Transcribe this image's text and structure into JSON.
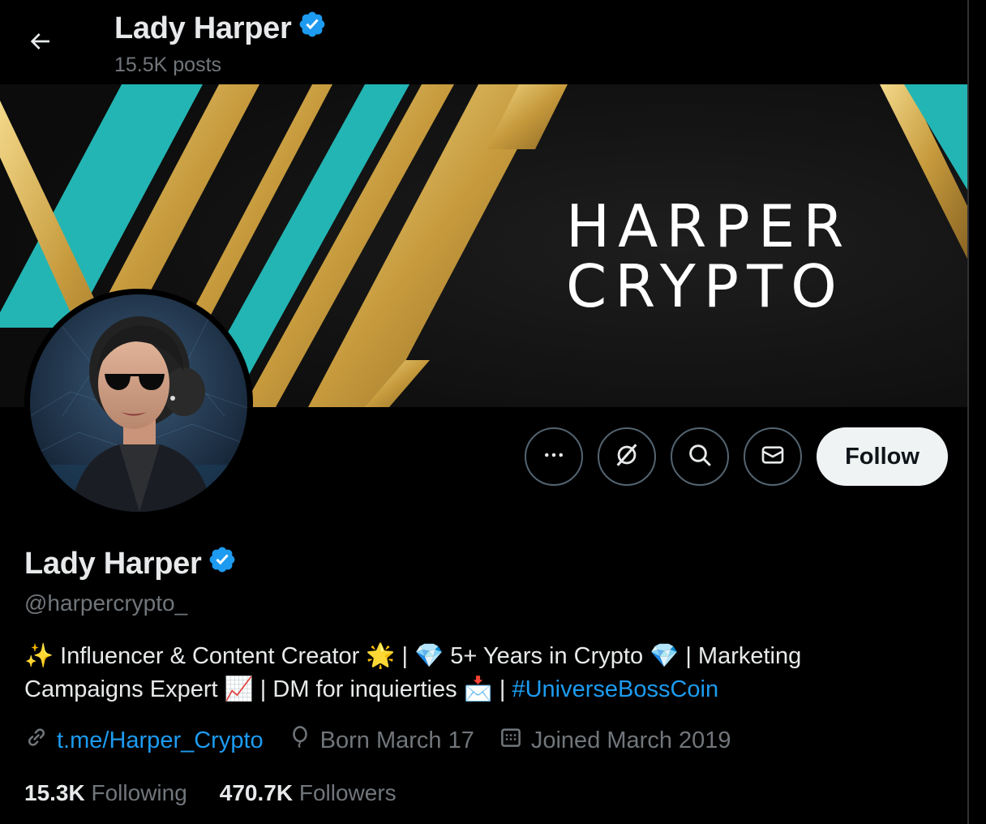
{
  "header": {
    "title": "Lady Harper",
    "posts_count": "15.5K posts"
  },
  "banner": {
    "line1": "HARPER",
    "line2": "CRYPTO",
    "colors": {
      "background": "#141414",
      "gold": "#c9a23f",
      "teal": "#23b5b3"
    }
  },
  "actions": {
    "more_icon": "more-dots-icon",
    "grok_icon": "grok-slash-icon",
    "search_icon": "search-icon",
    "message_icon": "envelope-icon",
    "follow_label": "Follow"
  },
  "profile": {
    "name": "Lady Harper",
    "handle": "@harpercrypto_",
    "verified_color": "#1d9bf0",
    "bio_line1": {
      "sparkles": "✨",
      "text1": " Influencer & Content Creator ",
      "glow": "🌟",
      "text2": " | ",
      "gem1": "💎",
      "text3": " 5+ Years in Crypto ",
      "gem2": "💎",
      "text4": " | Marketing"
    },
    "bio_line2": {
      "text1": "Campaigns Expert ",
      "chart": "📈",
      "text2": " | DM for inquierties ",
      "mail": "📩",
      "text3": " | ",
      "hashtag": "#UniverseBossCoin"
    },
    "link": "t.me/Harper_Crypto",
    "birthday": "Born March 17",
    "joined": "Joined March 2019"
  },
  "stats": {
    "following_count": "15.3K",
    "following_label": "Following",
    "followers_count": "470.7K",
    "followers_label": "Followers"
  }
}
